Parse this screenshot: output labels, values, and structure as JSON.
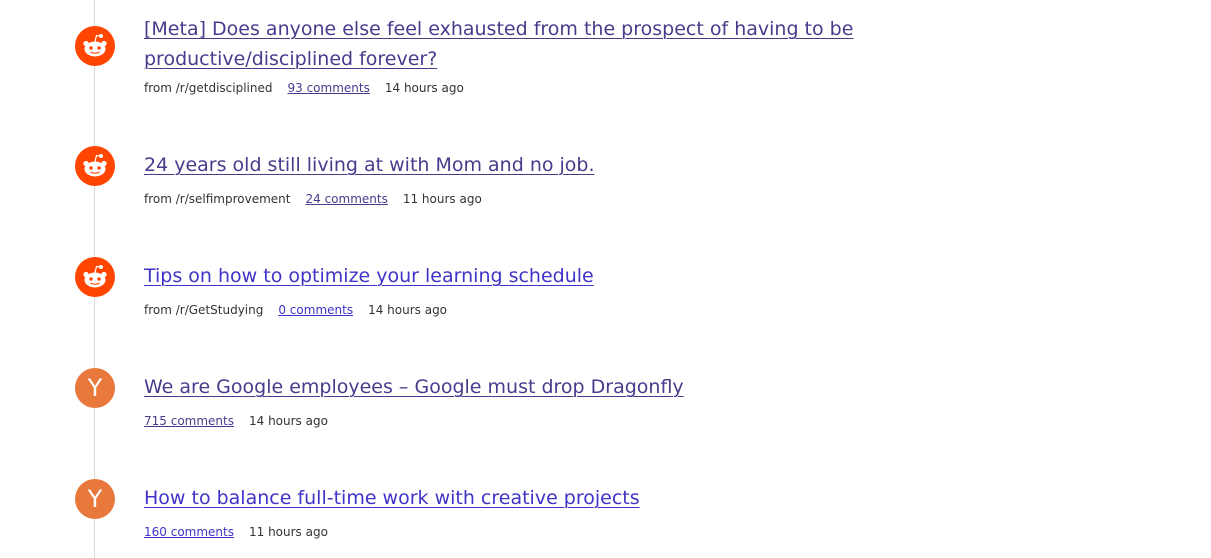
{
  "colors": {
    "reddit_orange": "#ff4500",
    "hn_orange": "#e8783c",
    "link_visited": "#4b3a8c",
    "link_unvisited": "#3f33c8",
    "timeline": "#d9d9d9"
  },
  "items": [
    {
      "source_icon": "reddit-icon",
      "title": "[Meta] Does anyone else feel exhausted from the prospect of having to be productive/disciplined forever?",
      "subreddit": "from /r/getdisciplined",
      "comments": "93 comments",
      "time": "14 hours ago"
    },
    {
      "source_icon": "reddit-icon",
      "title": "24 years old still living at with Mom and no job.",
      "subreddit": "from /r/selfimprovement",
      "comments": "24 comments",
      "time": "11 hours ago"
    },
    {
      "source_icon": "reddit-icon",
      "title": "Tips on how to optimize your learning schedule",
      "subreddit": "from /r/GetStudying",
      "comments": "0 comments",
      "time": "14 hours ago"
    },
    {
      "source_icon": "hacker-news-icon",
      "avatar_letter": "Y",
      "title": "We are Google employees – Google must drop Dragonfly",
      "comments": "715 comments",
      "time": "14 hours ago"
    },
    {
      "source_icon": "hacker-news-icon",
      "avatar_letter": "Y",
      "title": "How to balance full-time work with creative projects",
      "comments": "160 comments",
      "time": "11 hours ago"
    }
  ]
}
